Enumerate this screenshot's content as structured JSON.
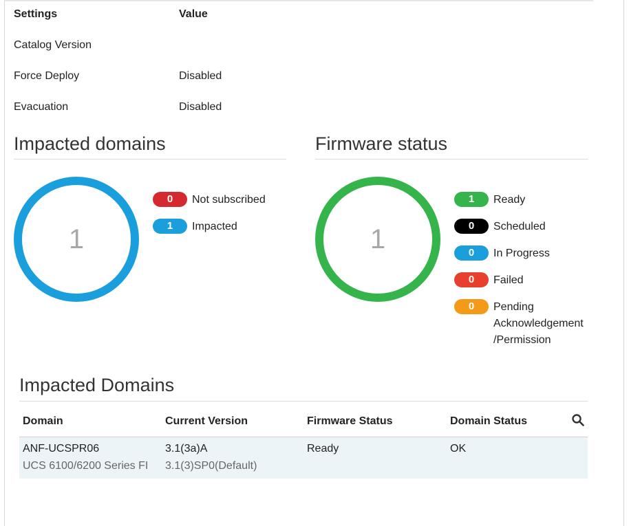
{
  "settings": {
    "header": {
      "key": "Settings",
      "value": "Value"
    },
    "rows": [
      {
        "key": "Catalog Version",
        "value": ""
      },
      {
        "key": "Force Deploy",
        "value": "Disabled"
      },
      {
        "key": "Evacuation",
        "value": "Disabled"
      }
    ]
  },
  "impacted_summary": {
    "title": "Impacted domains",
    "total": "1",
    "ring_color": "#1a9fdc",
    "legend": [
      {
        "count": "0",
        "label": "Not subscribed",
        "color": "#d42a2f"
      },
      {
        "count": "1",
        "label": "Impacted",
        "color": "#1a9fdc"
      }
    ]
  },
  "firmware_summary": {
    "title": "Firmware status",
    "total": "1",
    "ring_color": "#34b44a",
    "legend": [
      {
        "count": "1",
        "label": "Ready",
        "color": "#34b44a"
      },
      {
        "count": "0",
        "label": "Scheduled",
        "color": "#000000"
      },
      {
        "count": "0",
        "label": "In Progress",
        "color": "#1a9fdc"
      },
      {
        "count": "0",
        "label": "Failed",
        "color": "#e8402e"
      },
      {
        "count": "0",
        "label": "Pending",
        "label2": "Acknowledgement",
        "label3": "/Permission",
        "color": "#f39a18"
      }
    ]
  },
  "domains_table": {
    "title": "Impacted Domains",
    "columns": [
      "Domain",
      "Current Version",
      "Firmware Status",
      "Domain Status"
    ],
    "search_icon": "search-icon",
    "rows": [
      {
        "domain": "ANF-UCSPR06",
        "domain_sub": "UCS 6100/6200 Series FI",
        "current_version": "3.1(3a)A",
        "version_sub": "3.1(3)SP0(Default)",
        "firmware_status": "Ready",
        "domain_status": "OK"
      }
    ]
  }
}
